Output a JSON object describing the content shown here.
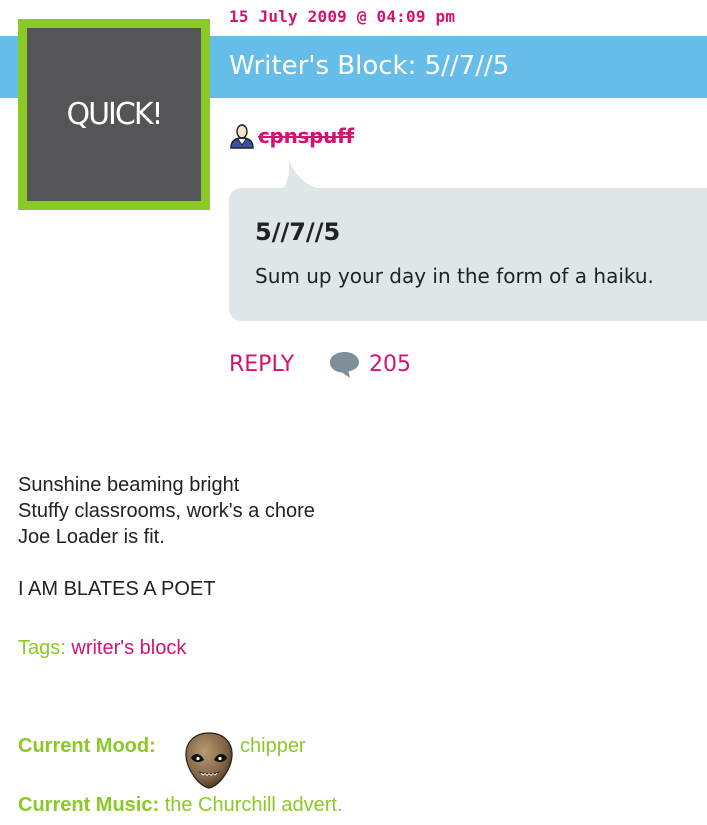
{
  "entry": {
    "date": "15 July 2009 @ 04:09 pm",
    "title": "Writer's Block: 5//7//5",
    "avatar_text": "QUICK!",
    "username": "cpnspuff",
    "question_title": "5//7//5",
    "question_text": "Sum up your day in the form of a haiku.",
    "reply_label": "REPLY",
    "comment_count": "205"
  },
  "body": {
    "lines": [
      "Sunshine beaming bright",
      "Stuffy classrooms, work's a chore",
      "Joe Loader is fit.",
      "",
      "I AM BLATES A POET"
    ]
  },
  "tags": {
    "label": "Tags:",
    "items": [
      "writer's block"
    ]
  },
  "mood": {
    "label": "Current Mood:",
    "value": "chipper",
    "icon": "alien-face-icon"
  },
  "music": {
    "label": "Current Music:",
    "value": "the Churchill advert."
  },
  "colors": {
    "accent_pink": "#d4126f",
    "title_bar_blue": "#67bde9",
    "frame_green": "#8ac926",
    "bubble_gray": "#dee6e8"
  }
}
